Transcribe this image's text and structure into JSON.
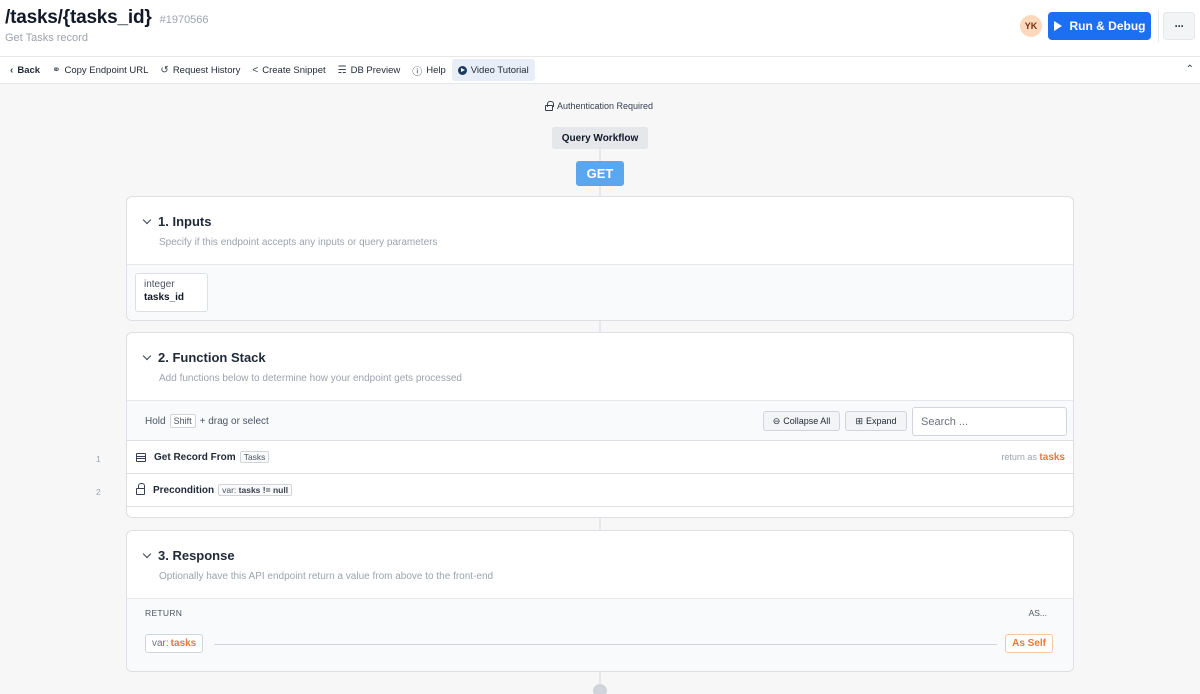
{
  "header": {
    "title": "/tasks/{tasks_id}",
    "record_id": "#1970566",
    "subtitle": "Get Tasks record",
    "avatar_initials": "YK",
    "run_button_label": "Run & Debug",
    "more_label": "···"
  },
  "toolbar": {
    "back": "Back",
    "copy_url": "Copy Endpoint URL",
    "request_history": "Request History",
    "create_snippet": "Create Snippet",
    "db_preview": "DB Preview",
    "help": "Help",
    "video_tutorial": "Video Tutorial"
  },
  "flow": {
    "auth": "Authentication Required",
    "workflow": "Query Workflow",
    "method": "GET"
  },
  "inputs": {
    "title": "1. Inputs",
    "description": "Specify if this endpoint accepts any inputs or query parameters",
    "items": [
      {
        "type": "integer",
        "name": "tasks_id"
      }
    ]
  },
  "function_stack": {
    "title": "2. Function Stack",
    "description": "Add functions below to determine how your endpoint gets processed",
    "hold_prefix": "Hold",
    "hold_key": "Shift",
    "hold_suffix": "+ drag or select",
    "collapse_all": "Collapse All",
    "expand": "Expand",
    "search_placeholder": "Search ...",
    "functions": [
      {
        "num": "1",
        "label": "Get Record From",
        "tag": "Tasks",
        "return_prefix": "return as",
        "return_var": "tasks"
      },
      {
        "num": "2",
        "label": "Precondition",
        "tag_prefix": "var:",
        "tag_var": "tasks",
        "tag_op": "!=",
        "tag_value": "null"
      }
    ]
  },
  "response": {
    "title": "3. Response",
    "description": "Optionally have this API endpoint return a value from above to the front-end",
    "return_label": "RETURN",
    "as_label": "AS...",
    "var_prefix": "var:",
    "var_name": "tasks",
    "as_value": "As Self"
  },
  "colors": {
    "accent": "#1d6ff2",
    "method": "#5aa7f0",
    "variable": "#e8793a"
  }
}
